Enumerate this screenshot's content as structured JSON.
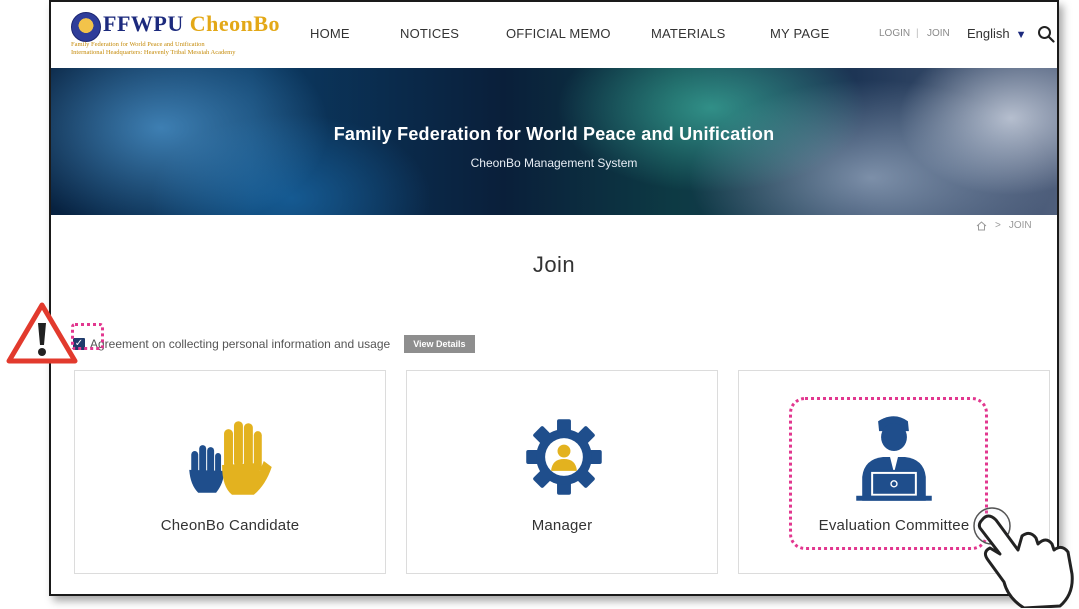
{
  "header": {
    "logo": {
      "brand_main": "FFWPU",
      "brand_accent": "CheonBo",
      "sub_line1": "Family Federation for World Peace and Unification",
      "sub_line2": "International Headquarters: Heavenly Tribal Messiah Academy"
    },
    "nav": [
      "HOME",
      "NOTICES",
      "OFFICIAL MEMO",
      "MATERIALS",
      "MY PAGE"
    ],
    "util": {
      "login": "LOGIN",
      "separator": "|",
      "join": "JOIN"
    },
    "language": "English",
    "icons": {
      "search": "search-icon",
      "language_caret": "caret-down-icon"
    }
  },
  "banner": {
    "title": "Family Federation for World Peace and Unification",
    "subtitle": "CheonBo Management System"
  },
  "breadcrumb": {
    "home_icon": "home-icon",
    "separator": ">",
    "current": "JOIN"
  },
  "page_title": "Join",
  "agreement": {
    "checked": true,
    "label": "Agreement on collecting personal information and usage",
    "details_button": "View Details"
  },
  "cards": [
    {
      "label": "CheonBo Candidate",
      "icon": "raised-hands-icon"
    },
    {
      "label": "Manager",
      "icon": "gear-person-icon"
    },
    {
      "label": "Evaluation Committee",
      "icon": "person-laptop-icon"
    }
  ],
  "annotations": {
    "warning": "warning-triangle-icon",
    "pointer": "pointing-hand-icon"
  },
  "colors": {
    "navy": "#1c2a7d",
    "gold": "#e3a817",
    "icon_blue": "#1f4e8c",
    "highlight": "#e2378f",
    "warning": "#e23a2d"
  }
}
